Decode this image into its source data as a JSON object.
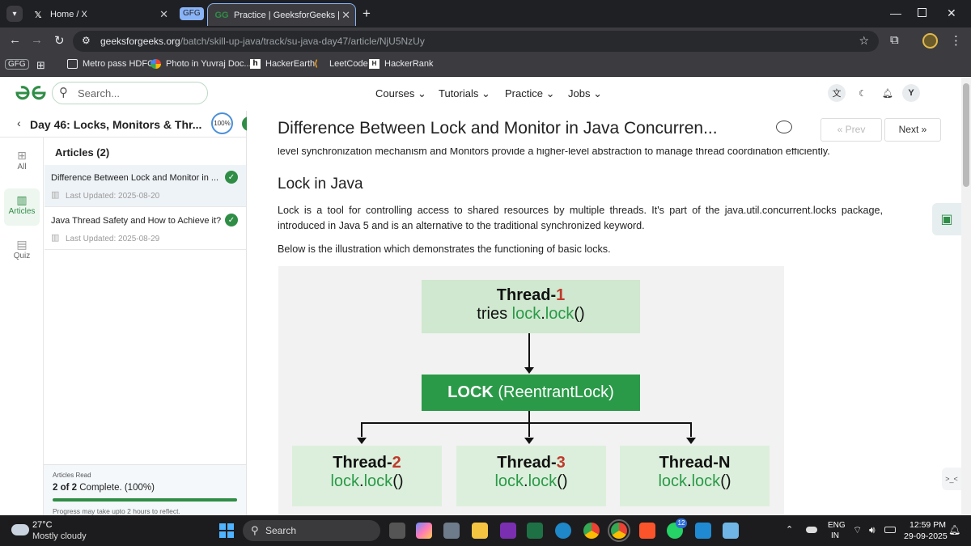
{
  "browser": {
    "tabs": [
      {
        "label": "Home / X",
        "icon": "x-logo-icon"
      },
      {
        "label": "GFG",
        "icon": "gfg-group-icon"
      },
      {
        "label": "Practice | GeeksforGeeks | A co",
        "icon": "gfg-logo-icon"
      }
    ],
    "url_domain": "geeksforgeeks.org",
    "url_path": "/batch/skill-up-java/track/su-java-day47/article/NjU5NzUy",
    "bookmarks": [
      {
        "label": "GFG",
        "icon": "gfg-group-icon"
      },
      {
        "label": "Metro pass HDFC",
        "icon": "folder-icon"
      },
      {
        "label": "Photo in Yuvraj Doc...",
        "icon": "google-photos-icon"
      },
      {
        "label": "HackerEarth",
        "icon": "hackerearth-icon"
      },
      {
        "label": "LeetCode",
        "icon": "leetcode-icon"
      },
      {
        "label": "HackerRank",
        "icon": "hackerrank-icon"
      }
    ]
  },
  "site": {
    "search_placeholder": "Search...",
    "menu": [
      "Courses",
      "Tutorials",
      "Practice",
      "Jobs"
    ],
    "avatar_letter": "Y"
  },
  "sidebar": {
    "title": "Day 46: Locks, Monitors & Thr...",
    "progress_badge": "100%",
    "rail": [
      {
        "label": "All",
        "icon": "grid-icon"
      },
      {
        "label": "Articles",
        "icon": "book-icon"
      },
      {
        "label": "Quiz",
        "icon": "clipboard-icon"
      }
    ],
    "articles_header": "Articles (2)",
    "articles": [
      {
        "title": "Difference Between Lock and Monitor in ...",
        "updated": "Last Updated: 2025-08-20"
      },
      {
        "title": "Java Thread Safety and How to Achieve it?",
        "updated": "Last Updated: 2025-08-29"
      }
    ],
    "progress": {
      "label": "Articles Read",
      "count": "2 of 2",
      "status": " Complete. (100%)",
      "fraction": 1.0,
      "note": "Progress may take upto 2 hours to reflect."
    }
  },
  "article": {
    "title": "Difference Between Lock and Monitor in Java Concurren...",
    "prev_label": "Prev",
    "next_label": "Next",
    "cut_line": "level synchronization mechanism and Monitors provide a higher-level abstraction to manage thread coordination efficiently.",
    "heading": "Lock in Java",
    "para1": "Lock is a tool for controlling access to shared resources by multiple threads. It's part of the java.util.concurrent.locks package, introduced in Java 5 and is an alternative to the traditional synchronized keyword.",
    "para2": "Below is the illustration which demonstrates the functioning of basic locks.",
    "diagram": {
      "top": {
        "name": "Thread-",
        "num": "1",
        "line2_a": "tries ",
        "line2_b": "lock",
        "line2_c": ".",
        "line2_d": "lock",
        "line2_e": "()"
      },
      "lock_a": "LOCK",
      "lock_b": " (ReentrantLock)",
      "threads": [
        {
          "name": "Thread-",
          "num": "2"
        },
        {
          "name": "Thread-",
          "num": "3"
        },
        {
          "name": "Thread-",
          "num": "N"
        }
      ],
      "call_a": "lock",
      "call_b": ".",
      "call_c": "lock",
      "call_d": "()"
    }
  },
  "taskbar": {
    "weather_temp": "27°C",
    "weather_desc": "Mostly cloudy",
    "search_label": "Search",
    "lang1": "ENG",
    "lang2": "IN",
    "time": "12:59 PM",
    "date": "29-09-2025",
    "whatsapp_badge": "12"
  },
  "colors": {
    "gfg_green": "#2f8d46",
    "diagram_dark_green": "#2a9a48",
    "diagram_light_green": "#cfe8cf",
    "diagram_red": "#c0392b"
  }
}
